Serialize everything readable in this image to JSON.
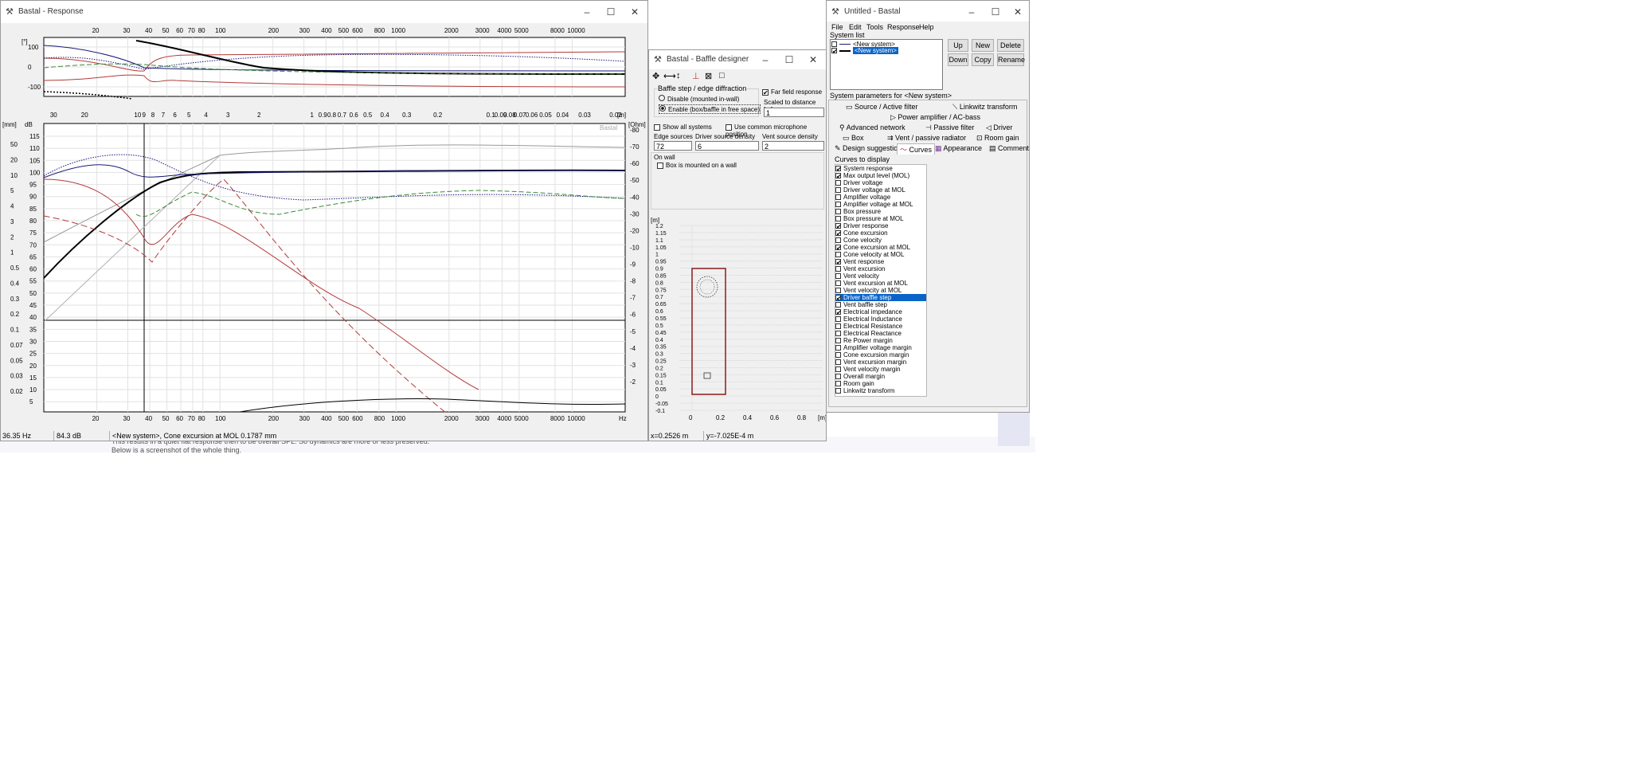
{
  "response_window": {
    "title": "Bastal - Response",
    "status": {
      "freq": "36.35 Hz",
      "level": "84.3 dB",
      "info": "<New system>, Cone excursion at MOL 0.1787 mm"
    },
    "top_plot": {
      "y_unit": "[°]",
      "x_ticks": [
        "20",
        "30",
        "40",
        "50",
        "60",
        "70",
        "80",
        "100",
        "200",
        "300",
        "400",
        "500",
        "600",
        "800",
        "1000",
        "2000",
        "3000",
        "4000",
        "5000",
        "8000",
        "10000"
      ],
      "y_ticks": [
        "100",
        "0",
        "-100"
      ]
    },
    "main_plot": {
      "top_ticks": [
        "30",
        "20",
        "10",
        "9",
        "8",
        "7",
        "6",
        "5",
        "4",
        "3",
        "2",
        "1",
        "0.9",
        "0.8",
        "0.7",
        "0.6",
        "0.5",
        "0.4",
        "0.3",
        "0.2",
        "0.1",
        "0.09",
        "0.08",
        "0.07",
        "0.06",
        "0.05",
        "0.04",
        "0.03",
        "0.02"
      ],
      "top_unit": "[m]",
      "bottom_ticks": [
        "20",
        "30",
        "40",
        "50",
        "60",
        "70",
        "80",
        "100",
        "200",
        "300",
        "400",
        "500",
        "600",
        "800",
        "1000",
        "2000",
        "3000",
        "4000",
        "5000",
        "8000",
        "10000"
      ],
      "bottom_unit": "Hz",
      "db_unit": "dB",
      "mm_unit": "[mm]",
      "ohm_unit": "[Ohm]",
      "db_ticks": [
        "115",
        "110",
        "105",
        "100",
        "95",
        "90",
        "85",
        "80",
        "75",
        "70",
        "65",
        "60",
        "55",
        "50",
        "45",
        "40",
        "35",
        "30",
        "25",
        "20",
        "15",
        "10",
        "5"
      ],
      "mm_ticks": [
        "50",
        "20",
        "10",
        "5",
        "4",
        "3",
        "2",
        "1",
        "0.5",
        "0.4",
        "0.3",
        "0.2",
        "0.1",
        "0.07",
        "0.05",
        "0.03",
        "0.02"
      ],
      "ohm_ticks": [
        "80",
        "70",
        "60",
        "50",
        "40",
        "30",
        "20",
        "10",
        "9",
        "8",
        "7",
        "6",
        "5",
        "4",
        "3",
        "2"
      ],
      "watermark": "Bastal"
    },
    "behind_text": [
      "This results in a quiet flat response then to be overall SPL. So dynamics are more or less preserved.",
      "Below is a screenshot of the whole thing."
    ]
  },
  "baffle_window": {
    "title": "Bastal - Baffle designer",
    "toolbar_icons": [
      "move-icon",
      "horizontal-resize-icon",
      "vertical-resize-icon",
      "driver-tool-icon",
      "vent-tool-icon",
      "rectangle-tool-icon"
    ],
    "group_title": "Baffle step / edge diffraction",
    "radio_disable": "Disable (mounted in-wall)",
    "radio_enable": "Enable (box/baffle in free space)",
    "far_field": "Far field response",
    "scaled_label": "Scaled to distance [m]",
    "scaled_value": "1",
    "show_all": "Show all systems",
    "common_mic": "Use common microphone position",
    "edge_sources_label": "Edge sources",
    "edge_sources_value": "72",
    "driver_density_label": "Driver source density",
    "driver_density_value": "6",
    "vent_density_label": "Vent source density",
    "vent_density_value": "2",
    "onwall_title": "On wall",
    "onwall_check": "Box is mounted on a wall",
    "y_unit": "[m]",
    "x_unit": "[m]",
    "y_ticks": [
      "1.2",
      "1.15",
      "1.1",
      "1.05",
      "1",
      "0.95",
      "0.9",
      "0.85",
      "0.8",
      "0.75",
      "0.7",
      "0.65",
      "0.6",
      "0.55",
      "0.5",
      "0.45",
      "0.4",
      "0.35",
      "0.3",
      "0.25",
      "0.2",
      "0.15",
      "0.1",
      "0.05",
      "0",
      "-0.05",
      "-0.1"
    ],
    "x_ticks": [
      "0",
      "0.2",
      "0.4",
      "0.6",
      "0.8"
    ],
    "status_x": "x=0.2526 m",
    "status_y": "y=-7.025E-4 m"
  },
  "main_window": {
    "title": "Untitled - Bastal",
    "menu": [
      "File",
      "Edit",
      "Tools",
      "Response",
      "Help"
    ],
    "system_list_label": "System list",
    "systems": [
      "<New system>",
      "<New system>"
    ],
    "buttons": {
      "up": "Up",
      "new": "New",
      "delete": "Delete",
      "down": "Down",
      "copy": "Copy",
      "rename": "Rename"
    },
    "params_label": "System parameters for <New system>",
    "tabs": {
      "source": "Source / Active filter",
      "linkwitz": "Linkwitz transform",
      "power": "Power amplifier / AC-bass",
      "advanced": "Advanced network",
      "passive": "Passive filter",
      "driver": "Driver",
      "box": "Box",
      "vent": "Vent / passive radiator",
      "room": "Room gain",
      "design": "Design suggestion",
      "curves": "Curves",
      "appearance": "Appearance",
      "comment": "Comment"
    },
    "curves_label": "Curves to display",
    "curves": [
      {
        "label": "System response",
        "checked": "✔"
      },
      {
        "label": "Max output level (MOL)",
        "checked": "✔"
      },
      {
        "label": "Driver voltage",
        "checked": ""
      },
      {
        "label": "Driver voltage at MOL",
        "checked": ""
      },
      {
        "label": "Amplifier voltage",
        "checked": ""
      },
      {
        "label": "Amplifier voltage at MOL",
        "checked": ""
      },
      {
        "label": "Box pressure",
        "checked": ""
      },
      {
        "label": "Box pressure at MOL",
        "checked": ""
      },
      {
        "label": "Driver response",
        "checked": "✔"
      },
      {
        "label": "Cone excursion",
        "checked": "✔"
      },
      {
        "label": "Cone velocity",
        "checked": ""
      },
      {
        "label": "Cone excursion at MOL",
        "checked": "✔"
      },
      {
        "label": "Cone velocity at MOL",
        "checked": ""
      },
      {
        "label": "Vent response",
        "checked": "✔"
      },
      {
        "label": "Vent excursion",
        "checked": ""
      },
      {
        "label": "Vent velocity",
        "checked": ""
      },
      {
        "label": "Vent excursion at MOL",
        "checked": ""
      },
      {
        "label": "Vent velocity at MOL",
        "checked": ""
      },
      {
        "label": "Driver baffle step",
        "checked": "✔"
      },
      {
        "label": "Vent baffle step",
        "checked": ""
      },
      {
        "label": "Electrical impedance",
        "checked": "✔"
      },
      {
        "label": "Electrical Inductance",
        "checked": ""
      },
      {
        "label": "Electrical Resistance",
        "checked": ""
      },
      {
        "label": "Electrical Reactance",
        "checked": ""
      },
      {
        "label": "Re Power margin",
        "checked": ""
      },
      {
        "label": "Amplifier voltage margin",
        "checked": ""
      },
      {
        "label": "Cone excursion margin",
        "checked": ""
      },
      {
        "label": "Vent excursion margin",
        "checked": ""
      },
      {
        "label": "Vent velocity margin",
        "checked": ""
      },
      {
        "label": "Overall margin",
        "checked": ""
      },
      {
        "label": "Room gain",
        "checked": ""
      },
      {
        "label": "Linkwitz transform",
        "checked": ""
      }
    ],
    "selected_curve": "Driver baffle step"
  },
  "colors": {
    "accent": "#0a64c8",
    "titlebar": "#ffffff",
    "panel": "#f0f0f0",
    "box_outline": "#8b1a1a"
  }
}
